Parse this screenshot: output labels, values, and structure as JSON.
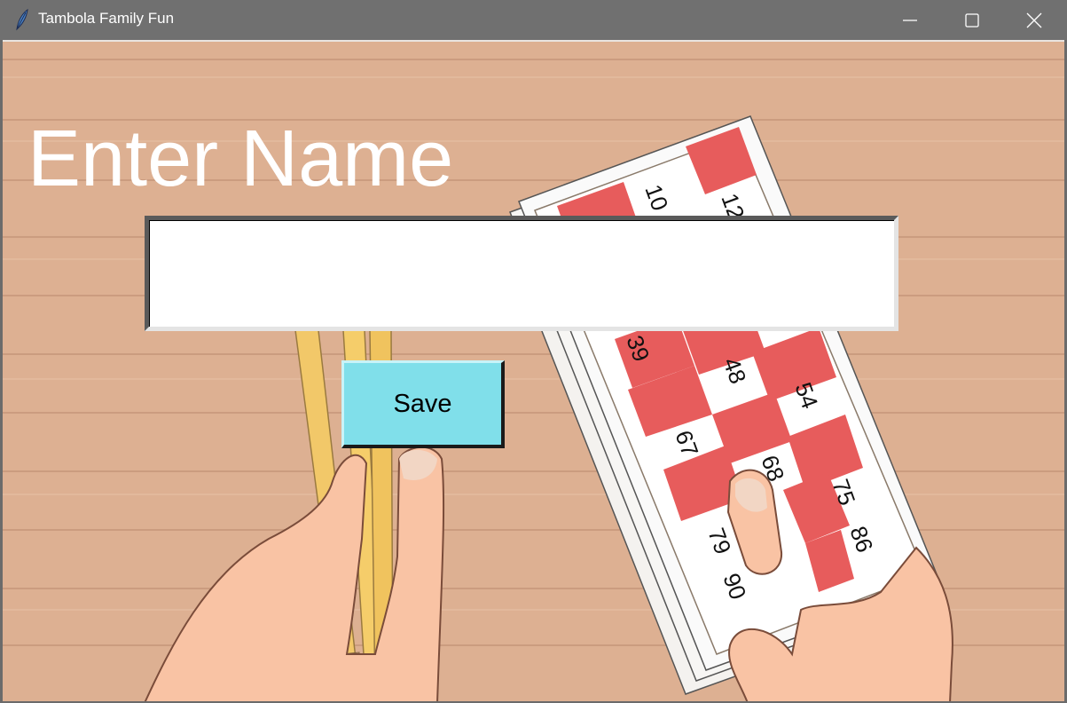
{
  "window": {
    "title": "Tambola Family Fun",
    "icon": "feather-icon",
    "controls": [
      "minimize-icon",
      "maximize-icon",
      "close-icon"
    ]
  },
  "form": {
    "heading": "Enter Name",
    "name_value": "",
    "save_label": "Save"
  },
  "ticket": {
    "numbers": [
      "10",
      "12",
      "39",
      "48",
      "54",
      "67",
      "68",
      "75",
      "79",
      "86",
      "90"
    ]
  },
  "colors": {
    "titlebar": "#707070",
    "wood": "#ddb092",
    "button": "#80dfea",
    "ticket_red": "#e75c5c"
  }
}
